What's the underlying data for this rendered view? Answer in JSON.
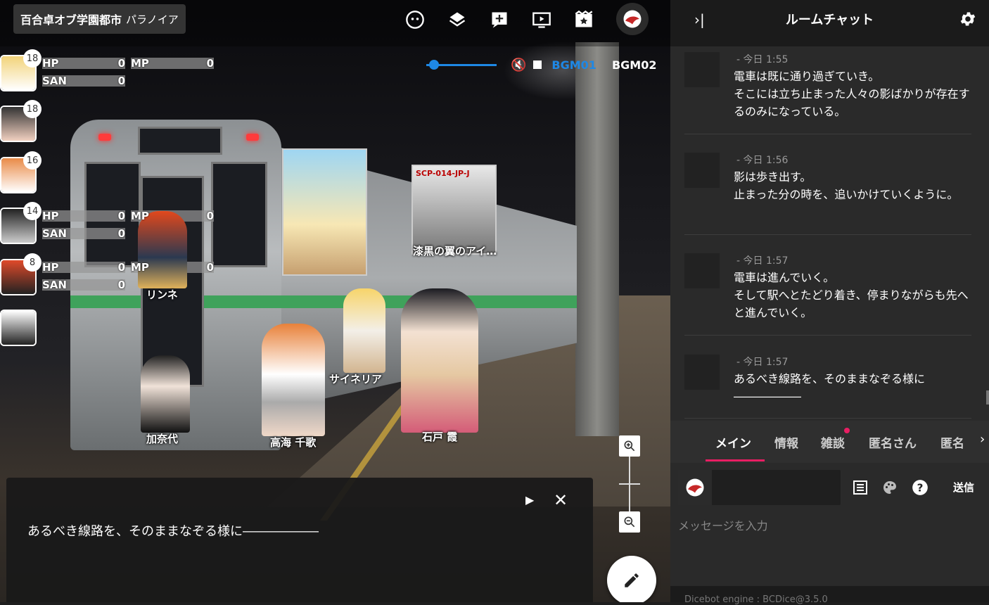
{
  "room": {
    "title": "百合卓オブ学園都市",
    "subtitle": "パラノイア"
  },
  "bgm": {
    "tracks": [
      "BGM01",
      "BGM02"
    ],
    "volume": 0.05
  },
  "characters": [
    {
      "level": "18",
      "stats": {
        "hp_label": "HP",
        "hp": "0",
        "mp_label": "MP",
        "mp": "0",
        "san_label": "SAN",
        "san": "0"
      }
    },
    {
      "level": "18"
    },
    {
      "level": "16"
    },
    {
      "level": "14",
      "stats": {
        "hp_label": "HP",
        "hp": "0",
        "mp_label": "MP",
        "mp": "0",
        "san_label": "SAN",
        "san": "0"
      }
    },
    {
      "level": "8",
      "stats": {
        "hp_label": "HP",
        "hp": "0",
        "mp_label": "MP",
        "mp": "0",
        "san_label": "SAN",
        "san": "0"
      }
    },
    {
      "level": ""
    }
  ],
  "scene": {
    "tokens": [
      {
        "name": "リンネ"
      },
      {
        "name": "漆黒の翼のアイ…"
      },
      {
        "name": "サイネリア"
      },
      {
        "name": "加奈代"
      },
      {
        "name": "高海 千歌"
      },
      {
        "name": "石戸 霞"
      }
    ],
    "card_text": "SCP-014-JP-J"
  },
  "dialog": {
    "text": "あるべき線路を、そのままなぞる様に――――――"
  },
  "chat": {
    "title": "ルームチャット",
    "messages": [
      {
        "time": "- 今日 1:55",
        "lines": [
          "電車は既に通り過ぎていき。",
          "そこには立ち止まった人々の影ばかりが存在するのみになっている。"
        ]
      },
      {
        "time": "- 今日 1:56",
        "lines": [
          "影は歩き出す。",
          "止まった分の時を、追いかけていくように。"
        ]
      },
      {
        "time": "- 今日 1:57",
        "lines": [
          "電車は進んでいく。",
          "そして駅へとたどり着き、停まりながらも先へと進んでいく。"
        ]
      },
      {
        "time": "- 今日 1:57",
        "lines": [
          "あるべき線路を、そのままなぞる様に――――――"
        ]
      }
    ],
    "tabs": [
      "メイン",
      "情報",
      "雑談",
      "匿名さん",
      "匿名"
    ],
    "placeholder": "メッセージを入力",
    "send_label": "送信",
    "footer": "Dicebot engine : BCDice@3.5.0"
  },
  "colors": {
    "accent": "#e91e63",
    "volume": "#1e88e5"
  }
}
